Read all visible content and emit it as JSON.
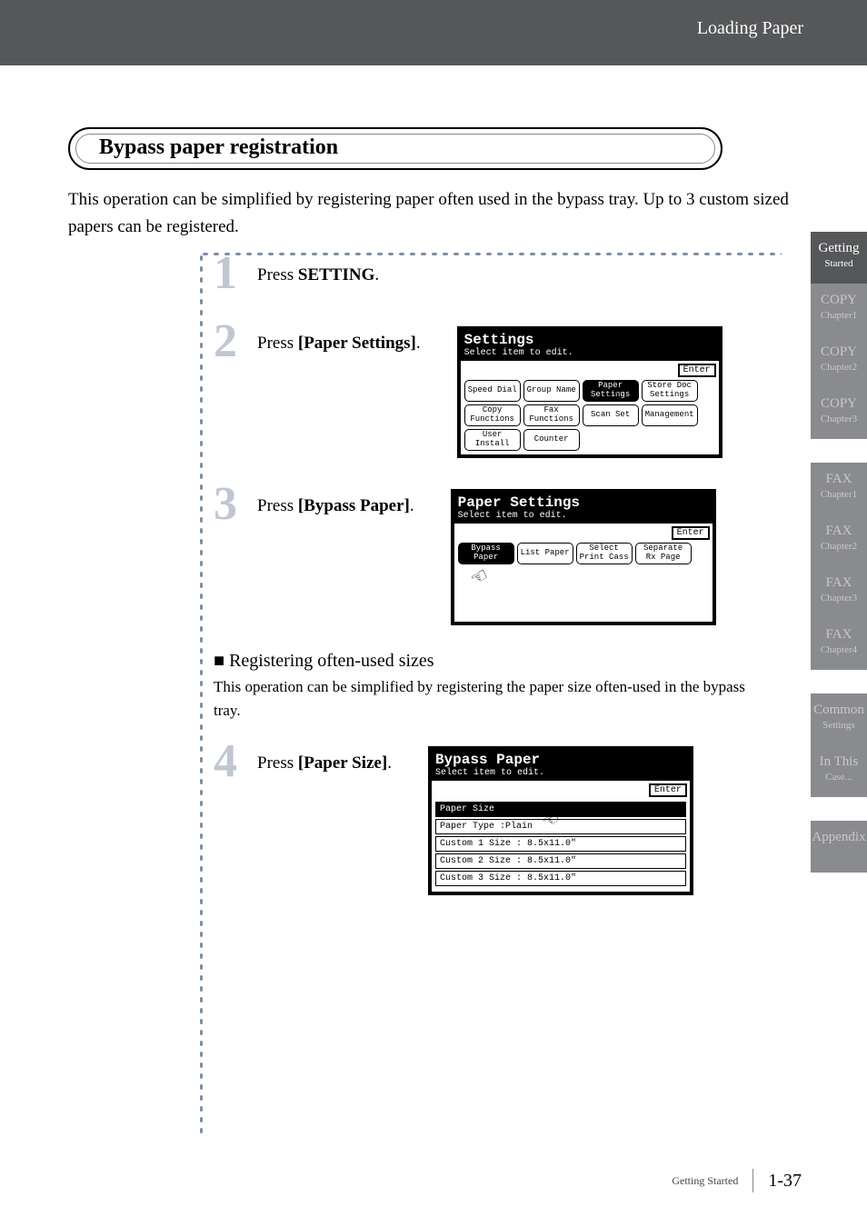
{
  "breadcrumb": "Loading Paper",
  "heading": "Bypass paper registration",
  "intro": "This operation can be simplified by registering paper often used in the bypass tray. Up to 3 custom sized papers can be registered.",
  "sideTabs": [
    {
      "title": "Getting",
      "sub": "Started"
    },
    {
      "title": "COPY",
      "sub": "Chapter1"
    },
    {
      "title": "COPY",
      "sub": "Chapter2"
    },
    {
      "title": "COPY",
      "sub": "Chapter3"
    },
    {
      "title": "FAX",
      "sub": "Chapter1"
    },
    {
      "title": "FAX",
      "sub": "Chapter2"
    },
    {
      "title": "FAX",
      "sub": "Chapter3"
    },
    {
      "title": "FAX",
      "sub": "Chapter4"
    },
    {
      "title": "Common",
      "sub": "Settings"
    },
    {
      "title": "In This",
      "sub": "Case..."
    },
    {
      "title": "Appendix",
      "sub": ""
    }
  ],
  "steps": {
    "s1": {
      "num": "1",
      "pre": "Press ",
      "key": "SETTING",
      "post": "."
    },
    "s2": {
      "num": "2",
      "pre": "Press ",
      "key": "[Paper Settings]",
      "post": "."
    },
    "s3": {
      "num": "3",
      "pre": "Press ",
      "key": "[Bypass Paper]",
      "post": "."
    },
    "s4": {
      "num": "4",
      "pre": "Press ",
      "key": "[Paper Size]",
      "post": "."
    }
  },
  "subheading": "Registering often-used sizes",
  "subbody": "This operation can be simplified by registering the paper size often-used in the bypass tray.",
  "screen2": {
    "title": "Settings",
    "subtitle": "Select item to edit.",
    "enter": "Enter",
    "buttons": [
      "Speed Dial",
      "Group Name",
      "Paper Settings",
      "Store Doc Settings",
      "Copy Functions",
      "Fax Functions",
      "Scan Set",
      "Management",
      "User Install",
      "Counter"
    ]
  },
  "screen3": {
    "title": "Paper Settings",
    "subtitle": "Select item to edit.",
    "enter": "Enter",
    "buttons": [
      "Bypass Paper",
      "List Paper",
      "Select Print Cass",
      "Separate Rx Page"
    ]
  },
  "screen4": {
    "title": "Bypass Paper",
    "subtitle": "Select item to edit.",
    "enter": "Enter",
    "rows": [
      "Paper Size",
      "Paper Type   :Plain",
      "Custom 1 Size : 8.5x11.0\"",
      "Custom 2 Size : 8.5x11.0\"",
      "Custom 3 Size : 8.5x11.0\""
    ]
  },
  "footer": {
    "section": "Getting Started",
    "page": "1-37"
  }
}
